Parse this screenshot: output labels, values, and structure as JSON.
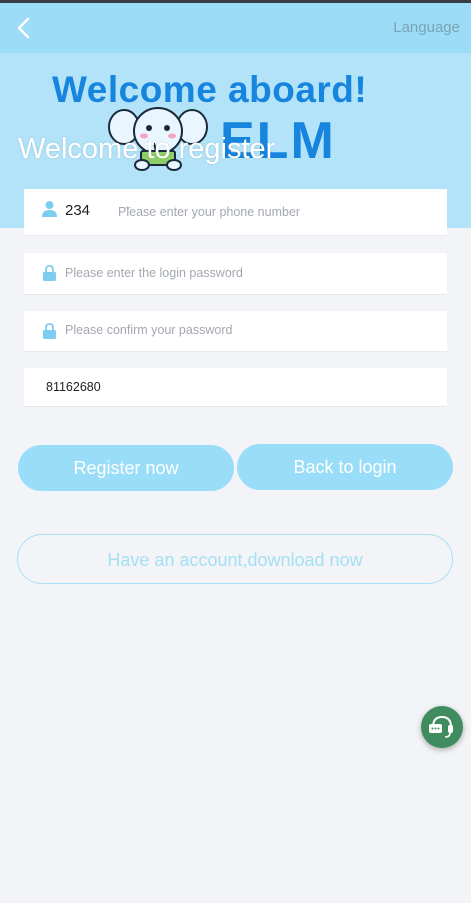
{
  "header": {
    "language_label": "Language"
  },
  "banner": {
    "headline": "Welcome aboard!",
    "logo_text": "ELM"
  },
  "page": {
    "title": "Welcome to register"
  },
  "form": {
    "country_code": "234",
    "phone_placeholder": "Please enter your phone number",
    "phone_value": "",
    "password_placeholder": "Please enter the login password",
    "confirm_placeholder": "Please confirm your password",
    "invite_code_value": "81162680"
  },
  "actions": {
    "register_label": "Register now",
    "back_login_label": "Back to login",
    "download_label": "Have an account,download now"
  },
  "colors": {
    "navbar": "#9ddcf6",
    "primary_button": "#99ddf8",
    "brand_blue": "#1785de",
    "support_button": "#3f8c5f"
  },
  "icons": {
    "back": "chevron-left-icon",
    "user": "user-icon",
    "lock": "lock-icon",
    "support": "headset-chat-icon"
  }
}
